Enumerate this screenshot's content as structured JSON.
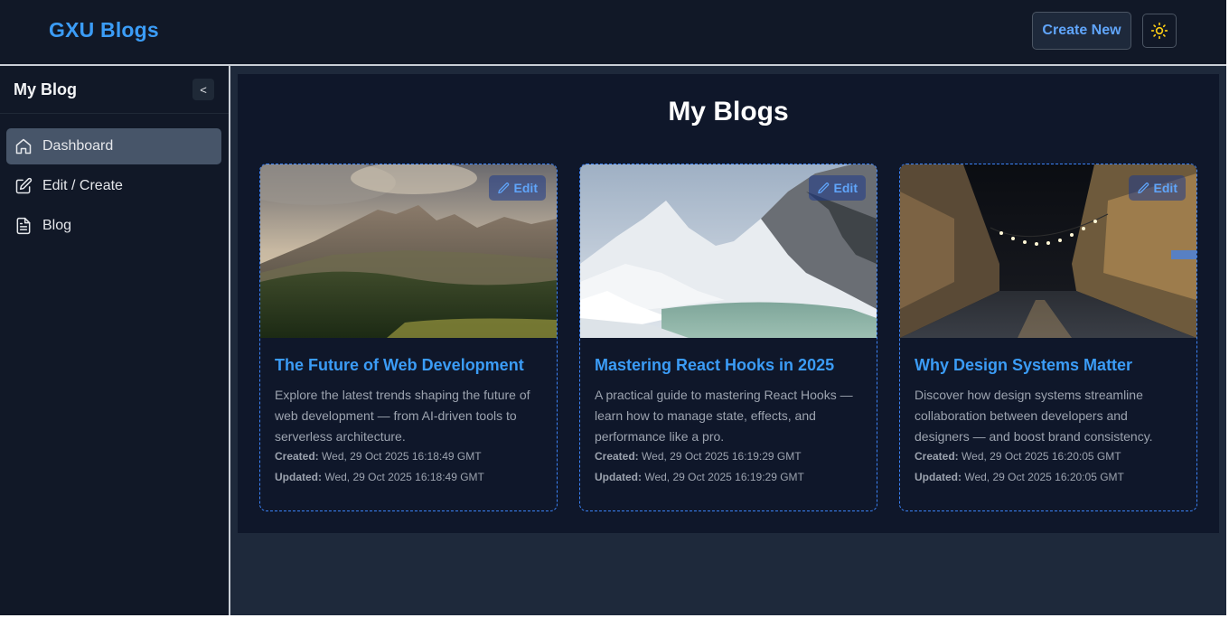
{
  "header": {
    "brand": "GXU Blogs",
    "create_label": "Create New",
    "theme_icon": "sun-icon"
  },
  "sidebar": {
    "title": "My Blog",
    "collapse_label": "<",
    "items": [
      {
        "label": "Dashboard",
        "icon": "home-icon",
        "active": true
      },
      {
        "label": "Edit / Create",
        "icon": "edit-icon",
        "active": false
      },
      {
        "label": "Blog",
        "icon": "document-icon",
        "active": false
      }
    ]
  },
  "main": {
    "title": "My Blogs",
    "cards": [
      {
        "title": "The Future of Web Development",
        "description": "Explore the latest trends shaping the future of web development — from AI-driven tools to serverless architecture.",
        "created_label": "Created:",
        "created": "Wed, 29 Oct 2025 16:18:49 GMT",
        "updated_label": "Updated:",
        "updated": "Wed, 29 Oct 2025 16:18:49 GMT",
        "edit_label": "Edit",
        "image": "mountain-forest-photo"
      },
      {
        "title": "Mastering React Hooks in 2025",
        "description": "A practical guide to mastering React Hooks — learn how to manage state, effects, and performance like a pro.",
        "created_label": "Created:",
        "created": "Wed, 29 Oct 2025 16:19:29 GMT",
        "updated_label": "Updated:",
        "updated": "Wed, 29 Oct 2025 16:19:29 GMT",
        "edit_label": "Edit",
        "image": "snowy-mountains-lake-photo"
      },
      {
        "title": "Why Design Systems Matter",
        "description": "Discover how design systems streamline collaboration between developers and designers — and boost brand consistency.",
        "created_label": "Created:",
        "created": "Wed, 29 Oct 2025 16:20:05 GMT",
        "updated_label": "Updated:",
        "updated": "Wed, 29 Oct 2025 16:20:05 GMT",
        "edit_label": "Edit",
        "image": "night-street-photo"
      }
    ]
  },
  "colors": {
    "accent": "#3b9cf6",
    "background": "#111827",
    "panel": "#0f172a",
    "active_nav": "#475569"
  }
}
